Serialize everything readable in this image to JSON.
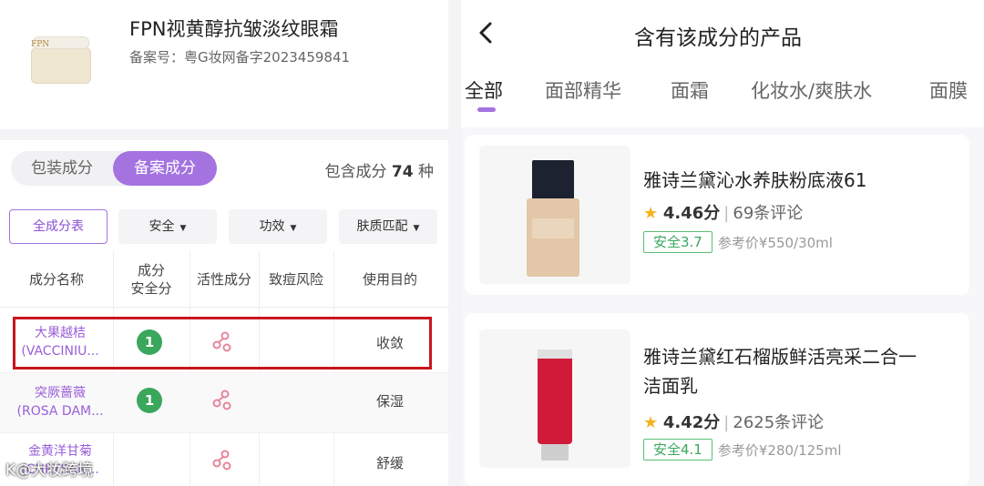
{
  "left": {
    "product_name": "FPN视黄醇抗皱淡纹眼霜",
    "registration": "备案号：粤G妆网备字2023459841",
    "jar_label": "FPN",
    "tabs": [
      "包装成分",
      "备案成分"
    ],
    "count_prefix": "包含成分 ",
    "count_value": "74",
    "count_suffix": " 种",
    "filters": {
      "all": "全成分表",
      "safety": "安全",
      "effect": "功效",
      "skin": "肤质匹配"
    },
    "table_headers": {
      "name": "成分名称",
      "safety_line1": "成分",
      "safety_line2": "安全分",
      "active": "活性成分",
      "acne": "致痘风险",
      "purpose": "使用目的"
    },
    "rows": [
      {
        "name_cn": "大果越桔",
        "name_en": "(VACCINIU...",
        "score": "1",
        "purpose": "收敛"
      },
      {
        "name_cn": "突厥蔷薇",
        "name_en": "(ROSA DAM...",
        "score": "1",
        "purpose": "保湿"
      },
      {
        "name_cn": "金黄洋甘菊",
        "name_en": "(CHRYSAN...",
        "score": "",
        "purpose": "舒缓"
      }
    ],
    "watermark": "K@大妆跨境"
  },
  "right": {
    "title": "含有该成分的产品",
    "categories": [
      "全部",
      "面部精华",
      "面霜",
      "化妆水/爽肤水",
      "面膜"
    ],
    "products": [
      {
        "title": "雅诗兰黛沁水养肤粉底液61",
        "rating": "4.46分",
        "reviews": "69条评论",
        "safety": "安全3.7",
        "price": "参考价¥550/30ml"
      },
      {
        "title": "雅诗兰黛红石榴版鲜活亮采二合一洁面乳",
        "rating": "4.42分",
        "reviews": "2625条评论",
        "safety": "安全4.1",
        "price": "参考价¥280/125ml"
      }
    ]
  },
  "colors": {
    "accent_purple": "#a473e0",
    "safe_green": "#3aa75c",
    "highlight_red": "#c8161d"
  }
}
